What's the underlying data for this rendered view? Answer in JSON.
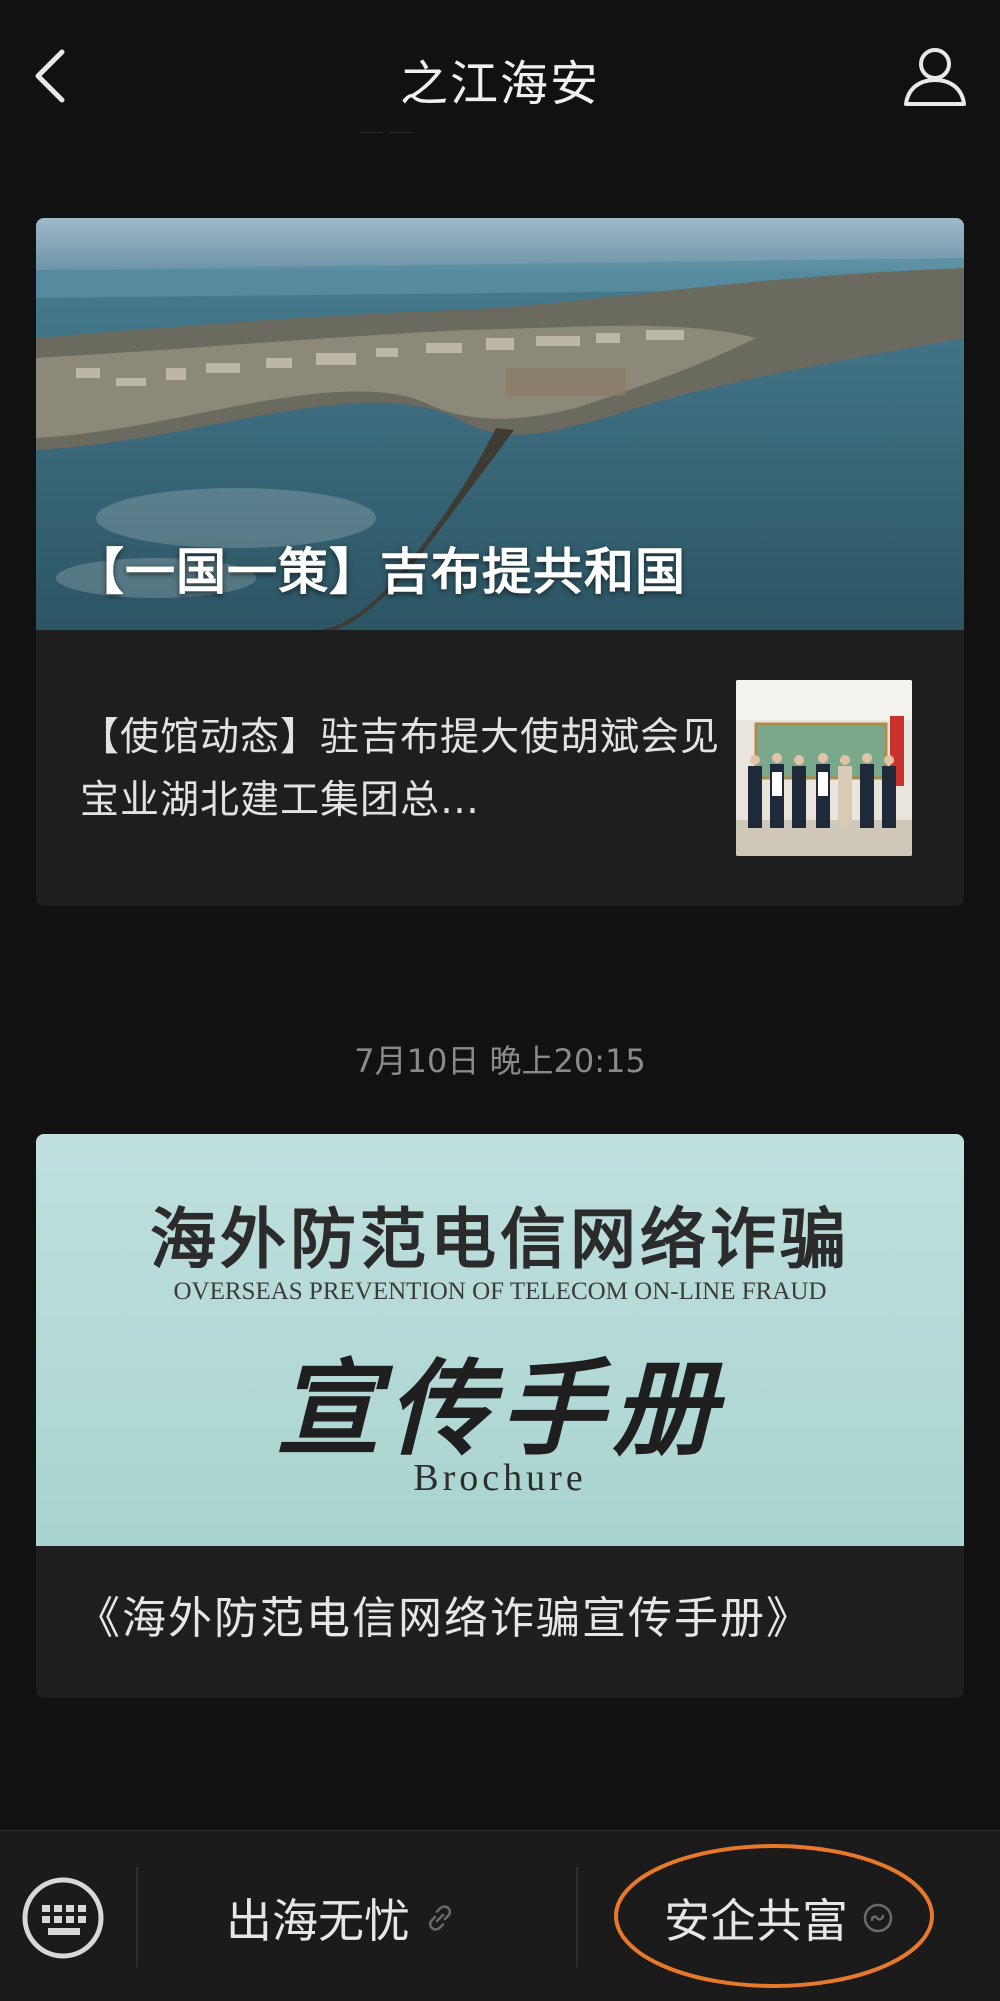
{
  "navbar": {
    "title": "之江海安",
    "back_icon": "chevron-left-icon",
    "profile_icon": "user-icon"
  },
  "card1": {
    "hero_caption": "【一国一策】吉布提共和国",
    "sub_article": {
      "text": "【使馆动态】驻吉布提大使胡斌会见宝业湖北建工集团总…"
    }
  },
  "timestamp": "7月10日 晚上20:15",
  "card2": {
    "banner_title": "海外防范电信网络诈骗",
    "banner_subtitle": "OVERSEAS PREVENTION OF TELECOM ON-LINE FRAUD",
    "banner_big": "宣传手册",
    "banner_english": "Brochure",
    "article_title": "《海外防范电信网络诈骗宣传手册》"
  },
  "bottom_menu": {
    "keyboard_icon": "keyboard-icon",
    "item1": {
      "label": "出海无忧",
      "icon": "link-icon"
    },
    "item2": {
      "label": "安企共富",
      "icon": "mini-program-icon"
    }
  },
  "colors": {
    "background": "#111111",
    "card": "#1e1e1e",
    "annotation": "#e8792a"
  }
}
